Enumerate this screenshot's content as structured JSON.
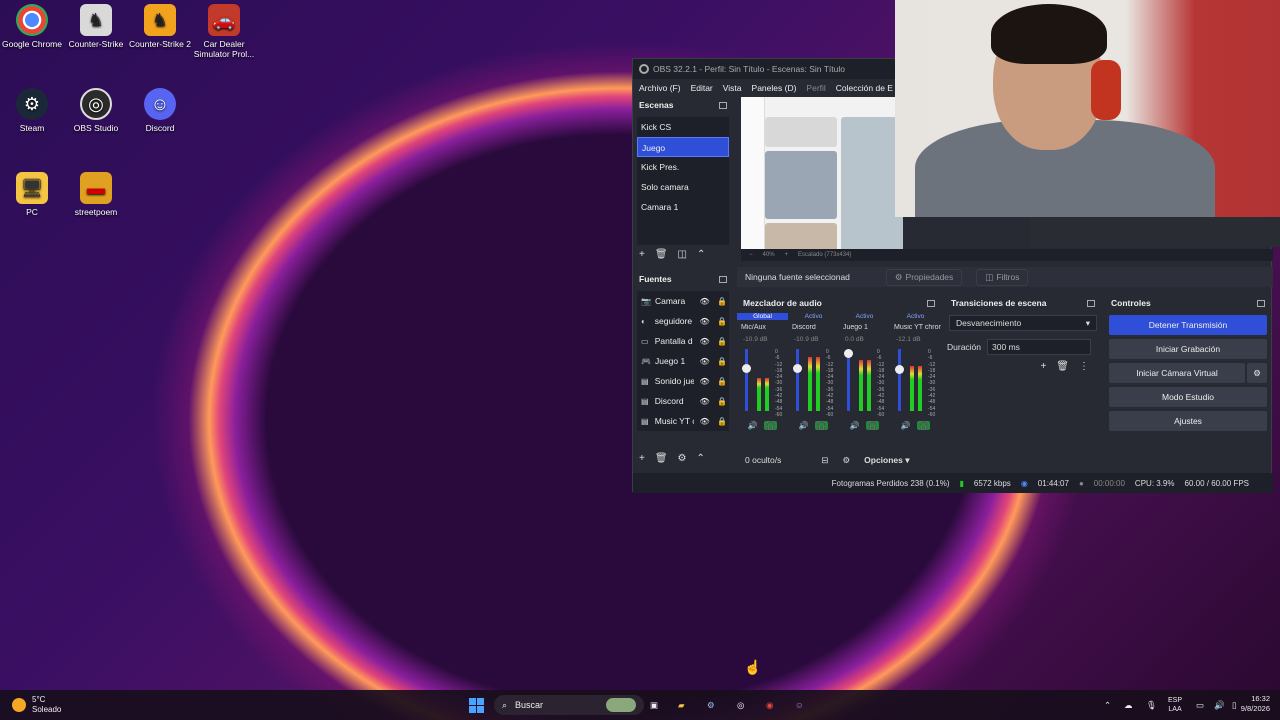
{
  "desktop": {
    "icons": [
      {
        "label": "Google Chrome",
        "icon": "chrome-icon"
      },
      {
        "label": "Counter-Strike",
        "icon": "counter-strike-icon"
      },
      {
        "label": "Counter-Strike 2",
        "icon": "counter-strike-2-icon"
      },
      {
        "label": "Car Dealer Simulator Prol...",
        "icon": "car-dealer-icon"
      },
      {
        "label": "Steam",
        "icon": "steam-icon"
      },
      {
        "label": "OBS Studio",
        "icon": "obs-icon"
      },
      {
        "label": "Discord",
        "icon": "discord-icon"
      },
      {
        "label": "PC",
        "icon": "pc-folder-icon"
      },
      {
        "label": "streetpoem",
        "icon": "streetpoem-folder-icon"
      }
    ]
  },
  "obs": {
    "title": "OBS 32.2.1 - Perfil: Sin Título - Escenas: Sin Título",
    "menu": [
      "Archivo (F)",
      "Editar",
      "Vista",
      "Paneles (D)",
      "Perfil",
      "Colección de E"
    ],
    "scenes_title": "Escenas",
    "scenes": [
      "Kick CS",
      "Juego",
      "Kick Pres.",
      "Solo camara",
      "Camara 1"
    ],
    "selected_scene": "Juego",
    "preview_zoom": "40%",
    "preview_scale": "Escalado (773x434)",
    "no_source_text": "Ninguna fuente seleccionad",
    "properties_label": "Propiedades",
    "filters_label": "Filtros",
    "sources_title": "Fuentes",
    "sources": [
      "Camara",
      "seguidore",
      "Pantalla d",
      "Juego 1",
      "Sonido jue",
      "Discord",
      "Music YT c"
    ],
    "hidden_count": "0 oculto/s",
    "options_label": "Opciones",
    "mixer_title": "Mezclador de audio",
    "mixer_tabs": [
      "Global",
      "Activo",
      "Activo",
      "Activo"
    ],
    "mixer_channels": [
      {
        "name": "Mic/Aux",
        "db": "-10.9 dB",
        "level": 0.55,
        "volume": 0.74
      },
      {
        "name": "Discord",
        "db": "-10.9 dB",
        "level": 0.9,
        "volume": 0.74
      },
      {
        "name": "Juego 1",
        "db": "0.0 dB",
        "level": 0.85,
        "volume": 1.0
      },
      {
        "name": "Music YT chrom",
        "db": "-12.1 dB",
        "level": 0.75,
        "volume": 0.72
      }
    ],
    "meter_scale": [
      "0",
      "-6",
      "-12",
      "-18",
      "-24",
      "-30",
      "-36",
      "-42",
      "-48",
      "-54",
      "-60"
    ],
    "transitions_title": "Transiciones de escena",
    "transition": "Desvanecimiento",
    "duration_label": "Duración",
    "duration_value": "300 ms",
    "controls_title": "Controles",
    "controls": [
      "Detener Transmisión",
      "Iniciar Grabación",
      "Iniciar Cámara Virtual",
      "Modo Estudio",
      "Ajustes"
    ],
    "status": {
      "dropped": "Fotogramas Perdidos 238 (0.1%)",
      "bitrate": "6572 kbps",
      "stream_time": "01:44:07",
      "rec_time": "00:00:00",
      "cpu": "CPU: 3.9%",
      "fps": "60.00 / 60.00 FPS"
    }
  },
  "taskbar": {
    "weather_temp": "5°C",
    "weather_desc": "Soleado",
    "search_placeholder": "Buscar",
    "lang_top": "ESP",
    "lang_bottom": "LAA",
    "time": "16:32",
    "date": "9/8/2026"
  }
}
